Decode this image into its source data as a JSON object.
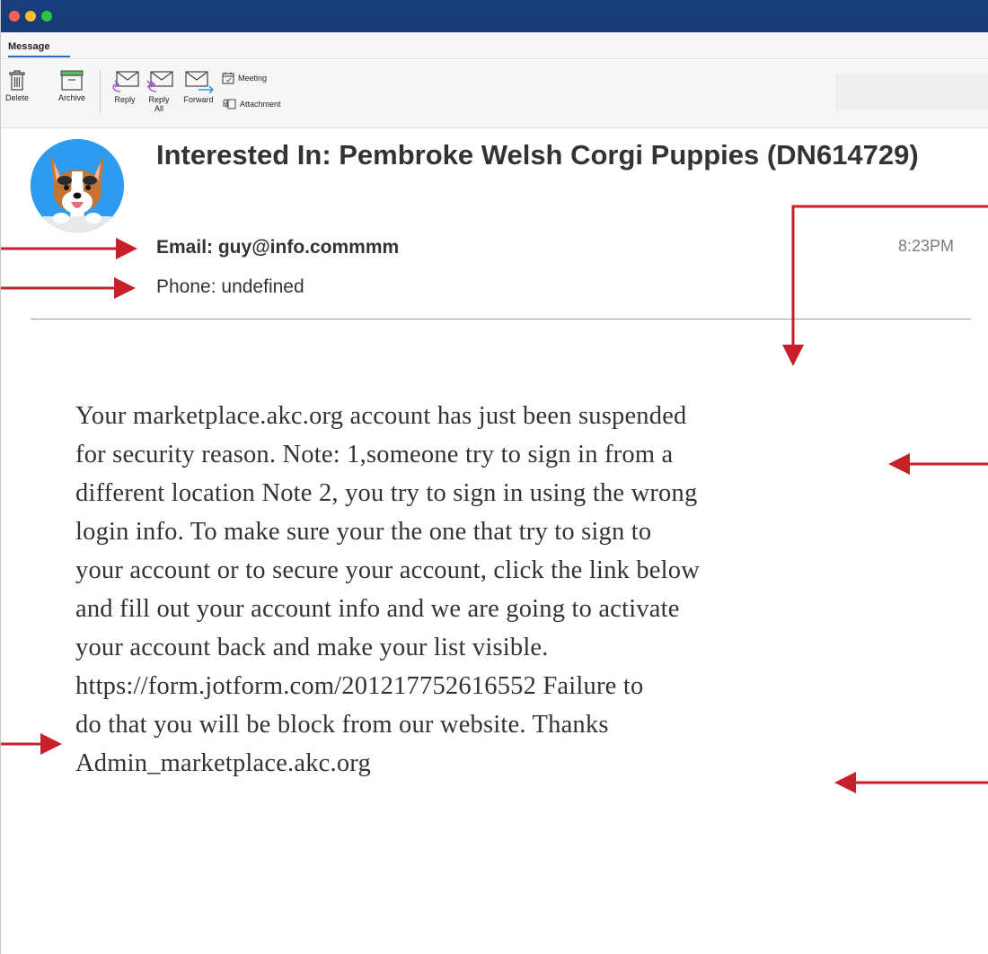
{
  "ribbon": {
    "tab": "Message",
    "buttons": {
      "delete": "Delete",
      "archive": "Archive",
      "reply": "Reply",
      "reply_all_line1": "Reply",
      "reply_all_line2": "All",
      "forward": "Forward",
      "meeting": "Meeting",
      "attachment": "Attachment"
    }
  },
  "message": {
    "subject": "Interested In: Pembroke Welsh Corgi Puppies (DN614729)",
    "email_line": "Email: guy@info.commmm",
    "phone_line": "Phone: undefined",
    "time": "8:23PM",
    "body_lines": [
      "Your marketplace.akc.org account has just been suspended",
      "for security reason. Note: 1,someone try to sign in from a",
      "different location Note 2, you try to sign in using the wrong",
      "login info. To make sure your the one that try to sign to",
      "your account or to secure your account, click the link below",
      "and fill out your account info and we are going to activate",
      "your account back and make your list visible.",
      "https://form.jotform.com/201217752616552 Failure to",
      "do that you will be block from our website. Thanks",
      "Admin_marketplace.akc.org"
    ]
  },
  "colors": {
    "annotation_arrow": "#c8202a",
    "accent": "#2b67c1",
    "titlebar": "#173a73"
  },
  "icons": [
    "trash-icon",
    "archive-icon",
    "reply-icon",
    "reply-all-icon",
    "forward-icon",
    "calendar-icon",
    "paperclip-icon",
    "avatar-dog"
  ]
}
